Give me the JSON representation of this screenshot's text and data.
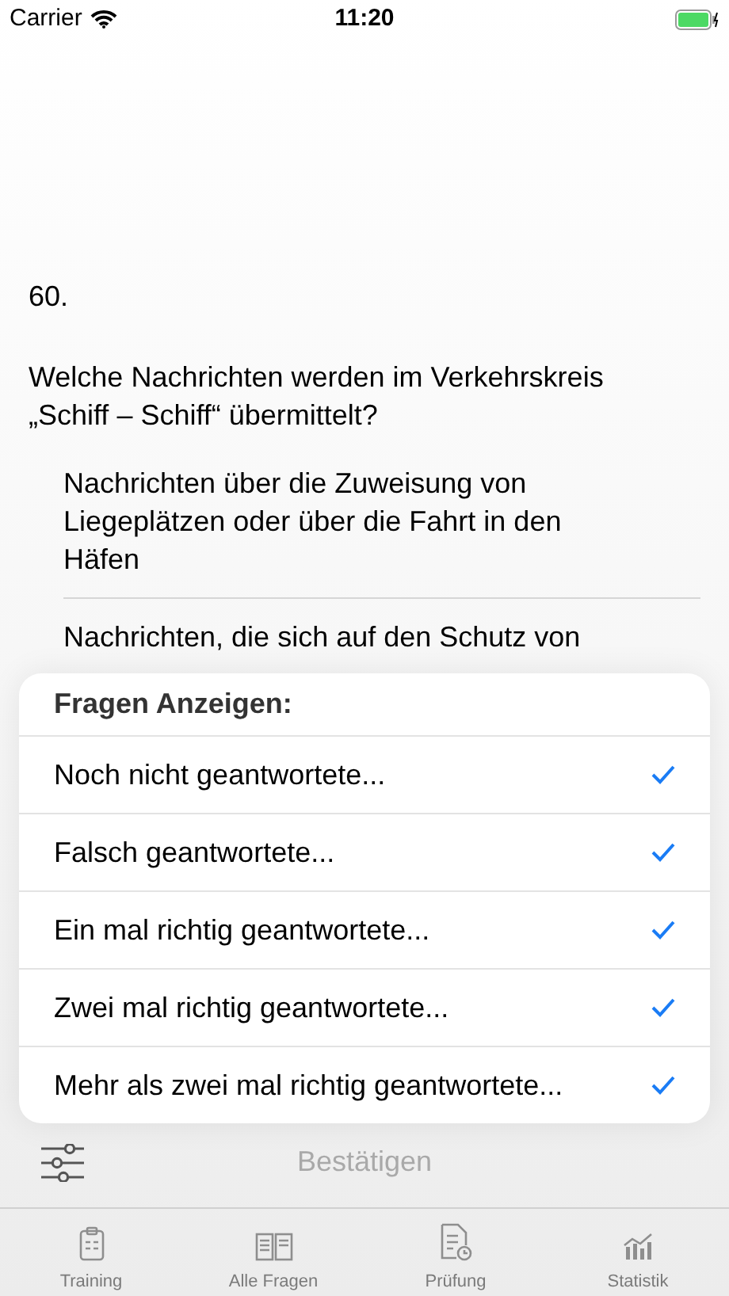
{
  "status_bar": {
    "carrier": "Carrier",
    "time": "11:20"
  },
  "question": {
    "number": "60.",
    "text": "Welche Nachrichten werden im Verkehrskreis „Schiff – Schiff“ übermittelt?",
    "answers": [
      "Nachrichten über die Zuweisung von Liegeplätzen oder über die Fahrt in den Häfen",
      "Nachrichten, die sich auf den Schutz von"
    ]
  },
  "filter_popover": {
    "title": "Fragen Anzeigen:",
    "items": [
      {
        "label": "Noch nicht geantwortete...",
        "checked": true
      },
      {
        "label": "Falsch geantwortete...",
        "checked": true
      },
      {
        "label": "Ein mal richtig geantwortete...",
        "checked": true
      },
      {
        "label": "Zwei mal richtig geantwortete...",
        "checked": true
      },
      {
        "label": "Mehr als zwei mal richtig geantwortete...",
        "checked": true
      }
    ]
  },
  "toolbar": {
    "confirm": {
      "label": "Bestätigen",
      "disabled": true
    }
  },
  "tabs": [
    {
      "label": "Training",
      "kind": "clipboard",
      "selected": false
    },
    {
      "label": "Alle Fragen",
      "kind": "book",
      "selected": false
    },
    {
      "label": "Prüfung",
      "kind": "exam",
      "selected": false
    },
    {
      "label": "Statistik",
      "kind": "chart",
      "selected": false
    }
  ]
}
